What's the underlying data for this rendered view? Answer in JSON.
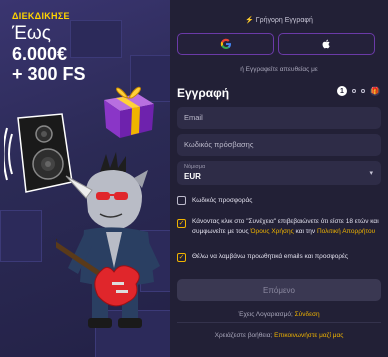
{
  "promo": {
    "tag": "ΔΙΕΚΔΙΚΗΣΕ",
    "line1": "Έως",
    "line2": "6.000€",
    "line3": "+ 300 FS"
  },
  "form": {
    "quick_register": "⚡ Γρήγορη Εγγραφή",
    "direct_register": "ή Εγγραφείτε απευθείας με",
    "title": "Εγγραφή",
    "current_step": "1",
    "email_placeholder": "Email",
    "password_placeholder": "Κωδικός πρόσβασης",
    "currency_label": "Νόμισμα",
    "currency_value": "EUR",
    "promo_code_label": "Κωδικός προσφοράς",
    "terms_text_1": "Κάνοντας κλικ στο \"Συνέχεια\" επιβεβαιώνετε ότι είστε 18 ετών και συμφωνείτε με τους ",
    "terms_link": "Όρους Χρήσης",
    "terms_text_2": " και την ",
    "privacy_link": "Πολιτική Απορρήτου",
    "emails_text": "Θέλω να λαμβάνω προωθητικά emails και προσφορές",
    "next_button": "Επόμενο",
    "have_account": "Έχεις Λογαριασμό; ",
    "login_link": "Σύνδεση",
    "need_help": "Χρειάζεστε βοήθεια; ",
    "contact_link": "Επικοινωνήστε μαζί μας"
  },
  "colors": {
    "accent": "#f0b400",
    "background": "#222036"
  }
}
